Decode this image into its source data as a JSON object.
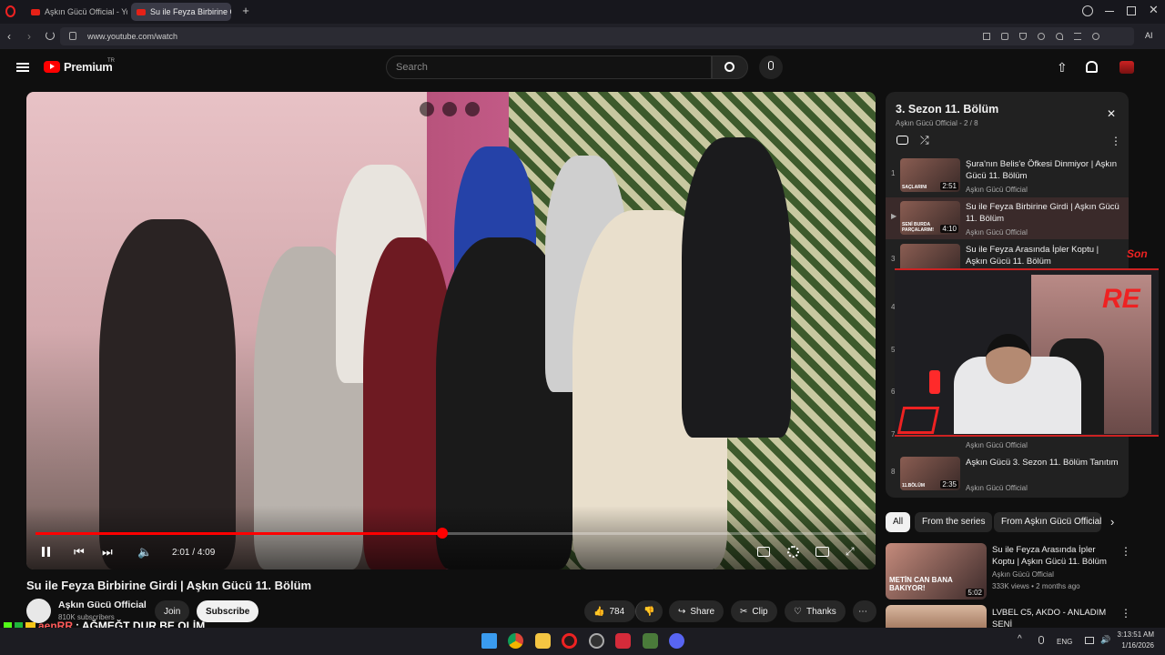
{
  "browser": {
    "tabs": [
      {
        "label": "Aşkın Gücü Official - YouT"
      },
      {
        "label": "Su ile Feyza Birbirine G"
      }
    ],
    "url": "www.youtube.com/watch",
    "ai_label": "AI"
  },
  "youtube": {
    "logo": "Premium",
    "region": "TR",
    "search_placeholder": "Search"
  },
  "player": {
    "current_time": "2:01",
    "duration": "4:09",
    "progress": 0.49,
    "time_sep": " / "
  },
  "video": {
    "title": "Su ile Feyza Birbirine Girdi | Aşkın Gücü 11. Bölüm",
    "channel": "Aşkın Gücü Official",
    "subscribers": "810K subscribers",
    "join": "Join",
    "subscribe": "Subscribe",
    "likes": "784",
    "share": "Share",
    "clip": "Clip",
    "thanks": "Thanks"
  },
  "playlist": {
    "title": "3. Sezon 11. Bölüm",
    "subtitle": "Aşkın Gücü Official - 2 / 8",
    "items": [
      {
        "num": "1",
        "title": "Şura'nın Belis'e Öfkesi Dinmiyor | Aşkın Gücü 11. Bölüm",
        "channel": "Aşkın Gücü Official",
        "duration": "2:51",
        "thumb_text": "SAÇLARINI"
      },
      {
        "num": "▶",
        "title": "Su ile Feyza Birbirine Girdi | Aşkın Gücü 11. Bölüm",
        "channel": "Aşkın Gücü Official",
        "duration": "4:10",
        "thumb_text": "SENİ BURDA PARÇALARIM!"
      },
      {
        "num": "3",
        "title": "Su ile Feyza Arasında İpler Koptu | Aşkın Gücü 11. Bölüm",
        "channel": "",
        "duration": "",
        "thumb_text": ""
      },
      {
        "num": "7",
        "title": "",
        "channel": "Aşkın Gücü Official",
        "duration": "",
        "thumb_text": ""
      },
      {
        "num": "8",
        "title": "Aşkın Gücü 3. Sezon 11. Bölüm Tanıtım",
        "channel": "Aşkın Gücü Official",
        "duration": "2:35",
        "thumb_text": "11.BÖLÜM"
      }
    ],
    "hidden_nums": [
      "4",
      "5",
      "6"
    ]
  },
  "chips": [
    "All",
    "From the series",
    "From Aşkın Gücü Official"
  ],
  "recommended": [
    {
      "title": "Su ile Feyza Arasında İpler Koptu | Aşkın Gücü 11. Bölüm",
      "channel": "Aşkın Gücü Official",
      "meta": "333K views • 2 months ago",
      "duration": "5:02",
      "thumb_text": "METİN CAN BANA BAKIYOR!"
    },
    {
      "title": "LVBEL C5, AKDO - ANLADIM SENİ",
      "channel": "",
      "meta": "",
      "duration": "",
      "thumb_text": ""
    }
  ],
  "overlay": {
    "son": "Son",
    "chat_user": "aenRR",
    "chat_msg": ": AĞMEĞT DUR BE OLİM",
    "webcam_logo": "RE"
  },
  "taskbar": {
    "lang": "ENG",
    "time": "3:13:51 AM",
    "date": "1/16/2026"
  },
  "colors": {
    "accent": "#ff0000",
    "bg": "#0f0f0f",
    "panel": "#212121"
  }
}
